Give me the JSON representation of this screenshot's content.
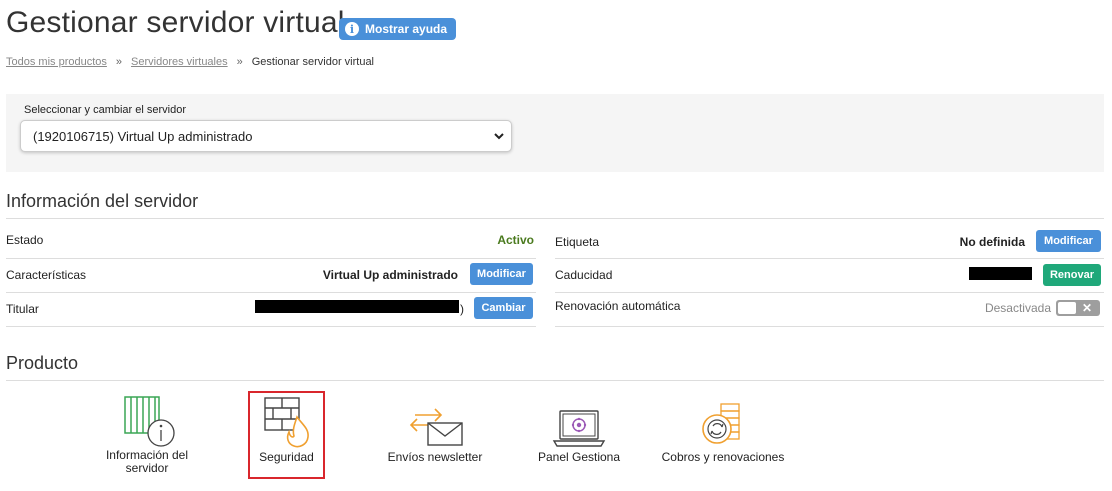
{
  "header": {
    "title": "Gestionar servidor virtual",
    "help_label": "Mostrar ayuda"
  },
  "breadcrumb": {
    "items": [
      "Todos mis productos",
      "Servidores virtuales",
      "Gestionar servidor virtual"
    ],
    "separator": "»"
  },
  "server_selector": {
    "label": "Seleccionar y cambiar el servidor",
    "selected": "(1920106715) Virtual Up administrado"
  },
  "server_info": {
    "title": "Información del servidor",
    "left": {
      "estado_label": "Estado",
      "estado_value": "Activo",
      "caracteristicas_label": "Características",
      "caracteristicas_value": "Virtual Up administrado",
      "caracteristicas_button": "Modificar",
      "titular_label": "Titular",
      "titular_suffix": ")",
      "titular_button": "Cambiar"
    },
    "right": {
      "etiqueta_label": "Etiqueta",
      "etiqueta_value": "No definida",
      "etiqueta_button": "Modificar",
      "caducidad_label": "Caducidad",
      "caducidad_button": "Renovar",
      "renovacion_label": "Renovación automática",
      "renovacion_value": "Desactivada",
      "toggle_symbol": "✕"
    }
  },
  "product": {
    "title": "Producto",
    "items": [
      {
        "label_line1": "Información del",
        "label_line2": "servidor",
        "icon": "server-info-icon"
      },
      {
        "label_line1": "Seguridad",
        "label_line2": "",
        "icon": "firewall-icon"
      },
      {
        "label_line1": "Envíos newsletter",
        "label_line2": "",
        "icon": "newsletter-icon"
      },
      {
        "label_line1": "Panel Gestiona",
        "label_line2": "",
        "icon": "laptop-panel-icon"
      },
      {
        "label_line1": "Cobros y renovaciones",
        "label_line2": "",
        "icon": "billing-icon"
      }
    ]
  },
  "colors": {
    "accent_blue": "#4a90d9",
    "accent_green": "#1fa87a",
    "active_green": "#4a7a1e",
    "selection_red": "#d9262c",
    "icon_green": "#3aa655",
    "icon_orange": "#f0a030",
    "icon_purple": "#9b59b6"
  }
}
